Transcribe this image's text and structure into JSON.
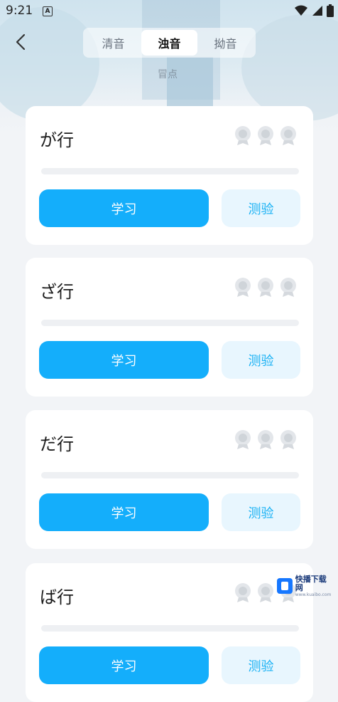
{
  "status_bar": {
    "time": "9:21",
    "notification_icon": "A"
  },
  "header": {
    "tabs": [
      {
        "label": "清音",
        "active": false
      },
      {
        "label": "浊音",
        "active": true
      },
      {
        "label": "拗音",
        "active": false
      }
    ],
    "background_sign": "冒点"
  },
  "cards": [
    {
      "title": "が行",
      "learn_label": "学习",
      "quiz_label": "测验",
      "progress": 0
    },
    {
      "title": "ざ行",
      "learn_label": "学习",
      "quiz_label": "测验",
      "progress": 0
    },
    {
      "title": "だ行",
      "learn_label": "学习",
      "quiz_label": "测验",
      "progress": 0
    },
    {
      "title": "ば行",
      "learn_label": "学习",
      "quiz_label": "测验",
      "progress": 0
    }
  ],
  "watermark": {
    "name": "快播下载网",
    "sub": "www.kuaibo.com"
  },
  "colors": {
    "primary": "#14aefb",
    "quiz_bg": "#e8f6fe",
    "quiz_text": "#19b1f4",
    "medal": "#d5d9de"
  }
}
